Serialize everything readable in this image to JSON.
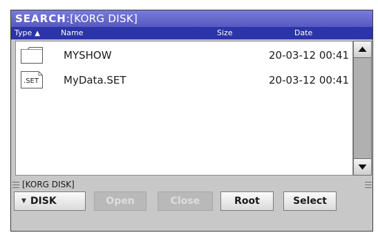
{
  "title": {
    "prefix": "SEARCH",
    "suffix": ":[KORG DISK]"
  },
  "columns": {
    "type": "Type",
    "sort_indicator": "▲",
    "name": "Name",
    "size": "Size",
    "date": "Date"
  },
  "files": [
    {
      "icon": "folder-icon",
      "icon_label": "",
      "name": "MYSHOW",
      "size": "",
      "date": "20-03-12 00:41"
    },
    {
      "icon": "set-file-icon",
      "icon_label": ".SET",
      "name": "MyData.SET",
      "size": "",
      "date": "20-03-12 00:41"
    }
  ],
  "path": "[KORG DISK]",
  "buttons": {
    "disk": "DISK",
    "open": "Open",
    "close": "Close",
    "root": "Root",
    "select": "Select"
  },
  "colors": {
    "title_bar": "#6467cc",
    "column_header": "#2b34a8",
    "panel": "#c8c8c8",
    "list_background": "#ffffff"
  }
}
